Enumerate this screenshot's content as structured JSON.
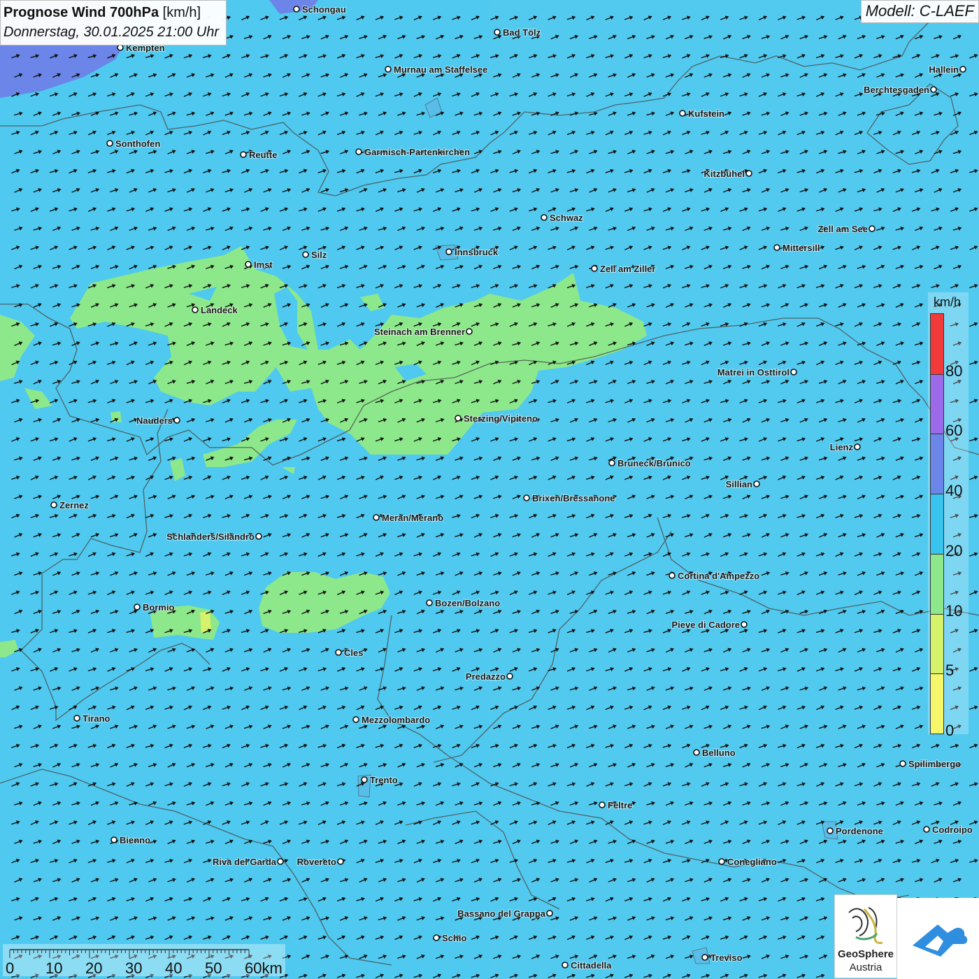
{
  "title": {
    "main_bold": "Prognose Wind 700hPa",
    "unit": "[km/h]",
    "date": "Donnerstag, 30.01.2025 21:00 Uhr"
  },
  "model": "Modell: C-LAEF",
  "colors": {
    "background": "#4fc9ef",
    "wind_10_20": "#8ce88a",
    "wind_40_plus": "#6b86e8",
    "arrow": "#111111",
    "border_line": "#4a4a4a"
  },
  "legend": {
    "unit": "km/h",
    "ticks": [
      "80",
      "60",
      "40",
      "20",
      "10",
      "5",
      "0"
    ],
    "bins": [
      {
        "from": 80,
        "to": 100,
        "color": "#f23a3a"
      },
      {
        "from": 60,
        "to": 80,
        "color": "#9b6ae8"
      },
      {
        "from": 40,
        "to": 60,
        "color": "#6b86e8"
      },
      {
        "from": 20,
        "to": 40,
        "color": "#38c4ee"
      },
      {
        "from": 10,
        "to": 20,
        "color": "#8ce88a"
      },
      {
        "from": 5,
        "to": 10,
        "color": "#d6f26a"
      },
      {
        "from": 0,
        "to": 5,
        "color": "#f6f66a"
      }
    ]
  },
  "scalebar": {
    "labels": [
      "0",
      "10",
      "20",
      "30",
      "40",
      "50",
      "60km"
    ]
  },
  "logos": {
    "geosphere_name": "GeoSphere",
    "geosphere_country": "Austria",
    "app_icon": "cloud-wind-icon"
  },
  "cities": [
    {
      "name": "Schongau",
      "anchor": "start"
    },
    {
      "name": "Bad Tölz",
      "anchor": "start"
    },
    {
      "name": "Kempten",
      "anchor": "start"
    },
    {
      "name": "Murnau am Staffelsee",
      "anchor": "start"
    },
    {
      "name": "Hallein",
      "anchor": "end"
    },
    {
      "name": "Berchtesgaden",
      "anchor": "end"
    },
    {
      "name": "Kufstein",
      "anchor": "start"
    },
    {
      "name": "Sonthofen",
      "anchor": "start"
    },
    {
      "name": "Reutte",
      "anchor": "start"
    },
    {
      "name": "Garmisch-Partenkirchen",
      "anchor": "start"
    },
    {
      "name": "Kitzbühel",
      "anchor": "end"
    },
    {
      "name": "Schwaz",
      "anchor": "start"
    },
    {
      "name": "Zell am See",
      "anchor": "end"
    },
    {
      "name": "Mittersill",
      "anchor": "start"
    },
    {
      "name": "Imst",
      "anchor": "start"
    },
    {
      "name": "Silz",
      "anchor": "start"
    },
    {
      "name": "Innsbruck",
      "anchor": "start"
    },
    {
      "name": "Zell am Ziller",
      "anchor": "start"
    },
    {
      "name": "Landeck",
      "anchor": "start"
    },
    {
      "name": "Steinach am Brenner",
      "anchor": "end"
    },
    {
      "name": "Matrei in Osttirol",
      "anchor": "end"
    },
    {
      "name": "Nauders",
      "anchor": "end"
    },
    {
      "name": "Sterzing/Vipiteno",
      "anchor": "start"
    },
    {
      "name": "Lienz",
      "anchor": "end"
    },
    {
      "name": "Bruneck/Brunico",
      "anchor": "start"
    },
    {
      "name": "Sillian",
      "anchor": "end"
    },
    {
      "name": "Brixen/Bressanone",
      "anchor": "start"
    },
    {
      "name": "Zernez",
      "anchor": "start"
    },
    {
      "name": "Meran/Merano",
      "anchor": "start"
    },
    {
      "name": "Schlanders/Silandro",
      "anchor": "end"
    },
    {
      "name": "Cortina d'Ampezzo",
      "anchor": "start"
    },
    {
      "name": "Bozen/Bolzano",
      "anchor": "start"
    },
    {
      "name": "Bormio",
      "anchor": "start"
    },
    {
      "name": "Pieve di Cadore",
      "anchor": "end"
    },
    {
      "name": "Cles",
      "anchor": "start"
    },
    {
      "name": "Predazzo",
      "anchor": "end"
    },
    {
      "name": "Tirano",
      "anchor": "start"
    },
    {
      "name": "Mezzolombardo",
      "anchor": "start"
    },
    {
      "name": "Belluno",
      "anchor": "start"
    },
    {
      "name": "Spilimbergo",
      "anchor": "start"
    },
    {
      "name": "Trento",
      "anchor": "start"
    },
    {
      "name": "Feltre",
      "anchor": "start"
    },
    {
      "name": "Pordenone",
      "anchor": "start"
    },
    {
      "name": "Codroipo",
      "anchor": "start"
    },
    {
      "name": "Bienno",
      "anchor": "start"
    },
    {
      "name": "Riva del Garda",
      "anchor": "end"
    },
    {
      "name": "Rovereto",
      "anchor": "end"
    },
    {
      "name": "Conegliano",
      "anchor": "start"
    },
    {
      "name": "Bassano del Grappa",
      "anchor": "end"
    },
    {
      "name": "Schio",
      "anchor": "start"
    },
    {
      "name": "Treviso",
      "anchor": "start"
    },
    {
      "name": "Cittadella",
      "anchor": "start"
    }
  ]
}
